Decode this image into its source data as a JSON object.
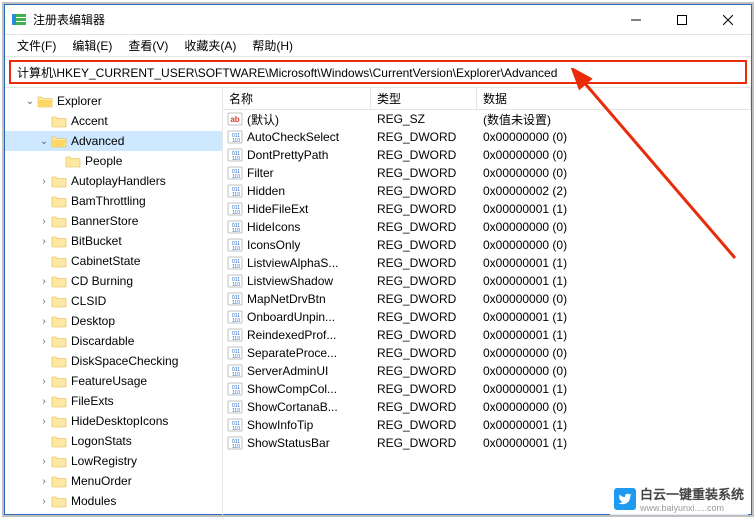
{
  "window": {
    "title": "注册表编辑器"
  },
  "menu": {
    "file": "文件(F)",
    "edit": "编辑(E)",
    "view": "查看(V)",
    "favorites": "收藏夹(A)",
    "help": "帮助(H)"
  },
  "address": {
    "value": "计算机\\HKEY_CURRENT_USER\\SOFTWARE\\Microsoft\\Windows\\CurrentVersion\\Explorer\\Advanced"
  },
  "tree": [
    {
      "indent": 1,
      "label": "Explorer",
      "expanded": true,
      "selected": false
    },
    {
      "indent": 2,
      "label": "Accent",
      "expandable": false
    },
    {
      "indent": 2,
      "label": "Advanced",
      "expanded": true,
      "selected": true
    },
    {
      "indent": 3,
      "label": "People",
      "expandable": false
    },
    {
      "indent": 2,
      "label": "AutoplayHandlers",
      "expandable": true
    },
    {
      "indent": 2,
      "label": "BamThrottling",
      "expandable": false
    },
    {
      "indent": 2,
      "label": "BannerStore",
      "expandable": true
    },
    {
      "indent": 2,
      "label": "BitBucket",
      "expandable": true
    },
    {
      "indent": 2,
      "label": "CabinetState",
      "expandable": false
    },
    {
      "indent": 2,
      "label": "CD Burning",
      "expandable": true
    },
    {
      "indent": 2,
      "label": "CLSID",
      "expandable": true
    },
    {
      "indent": 2,
      "label": "Desktop",
      "expandable": true
    },
    {
      "indent": 2,
      "label": "Discardable",
      "expandable": true
    },
    {
      "indent": 2,
      "label": "DiskSpaceChecking",
      "expandable": false
    },
    {
      "indent": 2,
      "label": "FeatureUsage",
      "expandable": true
    },
    {
      "indent": 2,
      "label": "FileExts",
      "expandable": true
    },
    {
      "indent": 2,
      "label": "HideDesktopIcons",
      "expandable": true
    },
    {
      "indent": 2,
      "label": "LogonStats",
      "expandable": false
    },
    {
      "indent": 2,
      "label": "LowRegistry",
      "expandable": true
    },
    {
      "indent": 2,
      "label": "MenuOrder",
      "expandable": true
    },
    {
      "indent": 2,
      "label": "Modules",
      "expandable": true
    }
  ],
  "columns": {
    "name": "名称",
    "type": "类型",
    "data": "数据"
  },
  "values": [
    {
      "kind": "sz",
      "name": "(默认)",
      "type": "REG_SZ",
      "data": "(数值未设置)"
    },
    {
      "kind": "dw",
      "name": "AutoCheckSelect",
      "type": "REG_DWORD",
      "data": "0x00000000 (0)"
    },
    {
      "kind": "dw",
      "name": "DontPrettyPath",
      "type": "REG_DWORD",
      "data": "0x00000000 (0)"
    },
    {
      "kind": "dw",
      "name": "Filter",
      "type": "REG_DWORD",
      "data": "0x00000000 (0)"
    },
    {
      "kind": "dw",
      "name": "Hidden",
      "type": "REG_DWORD",
      "data": "0x00000002 (2)"
    },
    {
      "kind": "dw",
      "name": "HideFileExt",
      "type": "REG_DWORD",
      "data": "0x00000001 (1)"
    },
    {
      "kind": "dw",
      "name": "HideIcons",
      "type": "REG_DWORD",
      "data": "0x00000000 (0)"
    },
    {
      "kind": "dw",
      "name": "IconsOnly",
      "type": "REG_DWORD",
      "data": "0x00000000 (0)"
    },
    {
      "kind": "dw",
      "name": "ListviewAlphaS...",
      "type": "REG_DWORD",
      "data": "0x00000001 (1)"
    },
    {
      "kind": "dw",
      "name": "ListviewShadow",
      "type": "REG_DWORD",
      "data": "0x00000001 (1)"
    },
    {
      "kind": "dw",
      "name": "MapNetDrvBtn",
      "type": "REG_DWORD",
      "data": "0x00000000 (0)"
    },
    {
      "kind": "dw",
      "name": "OnboardUnpin...",
      "type": "REG_DWORD",
      "data": "0x00000001 (1)"
    },
    {
      "kind": "dw",
      "name": "ReindexedProf...",
      "type": "REG_DWORD",
      "data": "0x00000001 (1)"
    },
    {
      "kind": "dw",
      "name": "SeparateProce...",
      "type": "REG_DWORD",
      "data": "0x00000000 (0)"
    },
    {
      "kind": "dw",
      "name": "ServerAdminUI",
      "type": "REG_DWORD",
      "data": "0x00000000 (0)"
    },
    {
      "kind": "dw",
      "name": "ShowCompCol...",
      "type": "REG_DWORD",
      "data": "0x00000001 (1)"
    },
    {
      "kind": "dw",
      "name": "ShowCortanaB...",
      "type": "REG_DWORD",
      "data": "0x00000000 (0)"
    },
    {
      "kind": "dw",
      "name": "ShowInfoTip",
      "type": "REG_DWORD",
      "data": "0x00000001 (1)"
    },
    {
      "kind": "dw",
      "name": "ShowStatusBar",
      "type": "REG_DWORD",
      "data": "0x00000001 (1)"
    }
  ],
  "watermark": {
    "main": "白云一键重装系统",
    "sub": "www.baiyunxi.....com"
  }
}
